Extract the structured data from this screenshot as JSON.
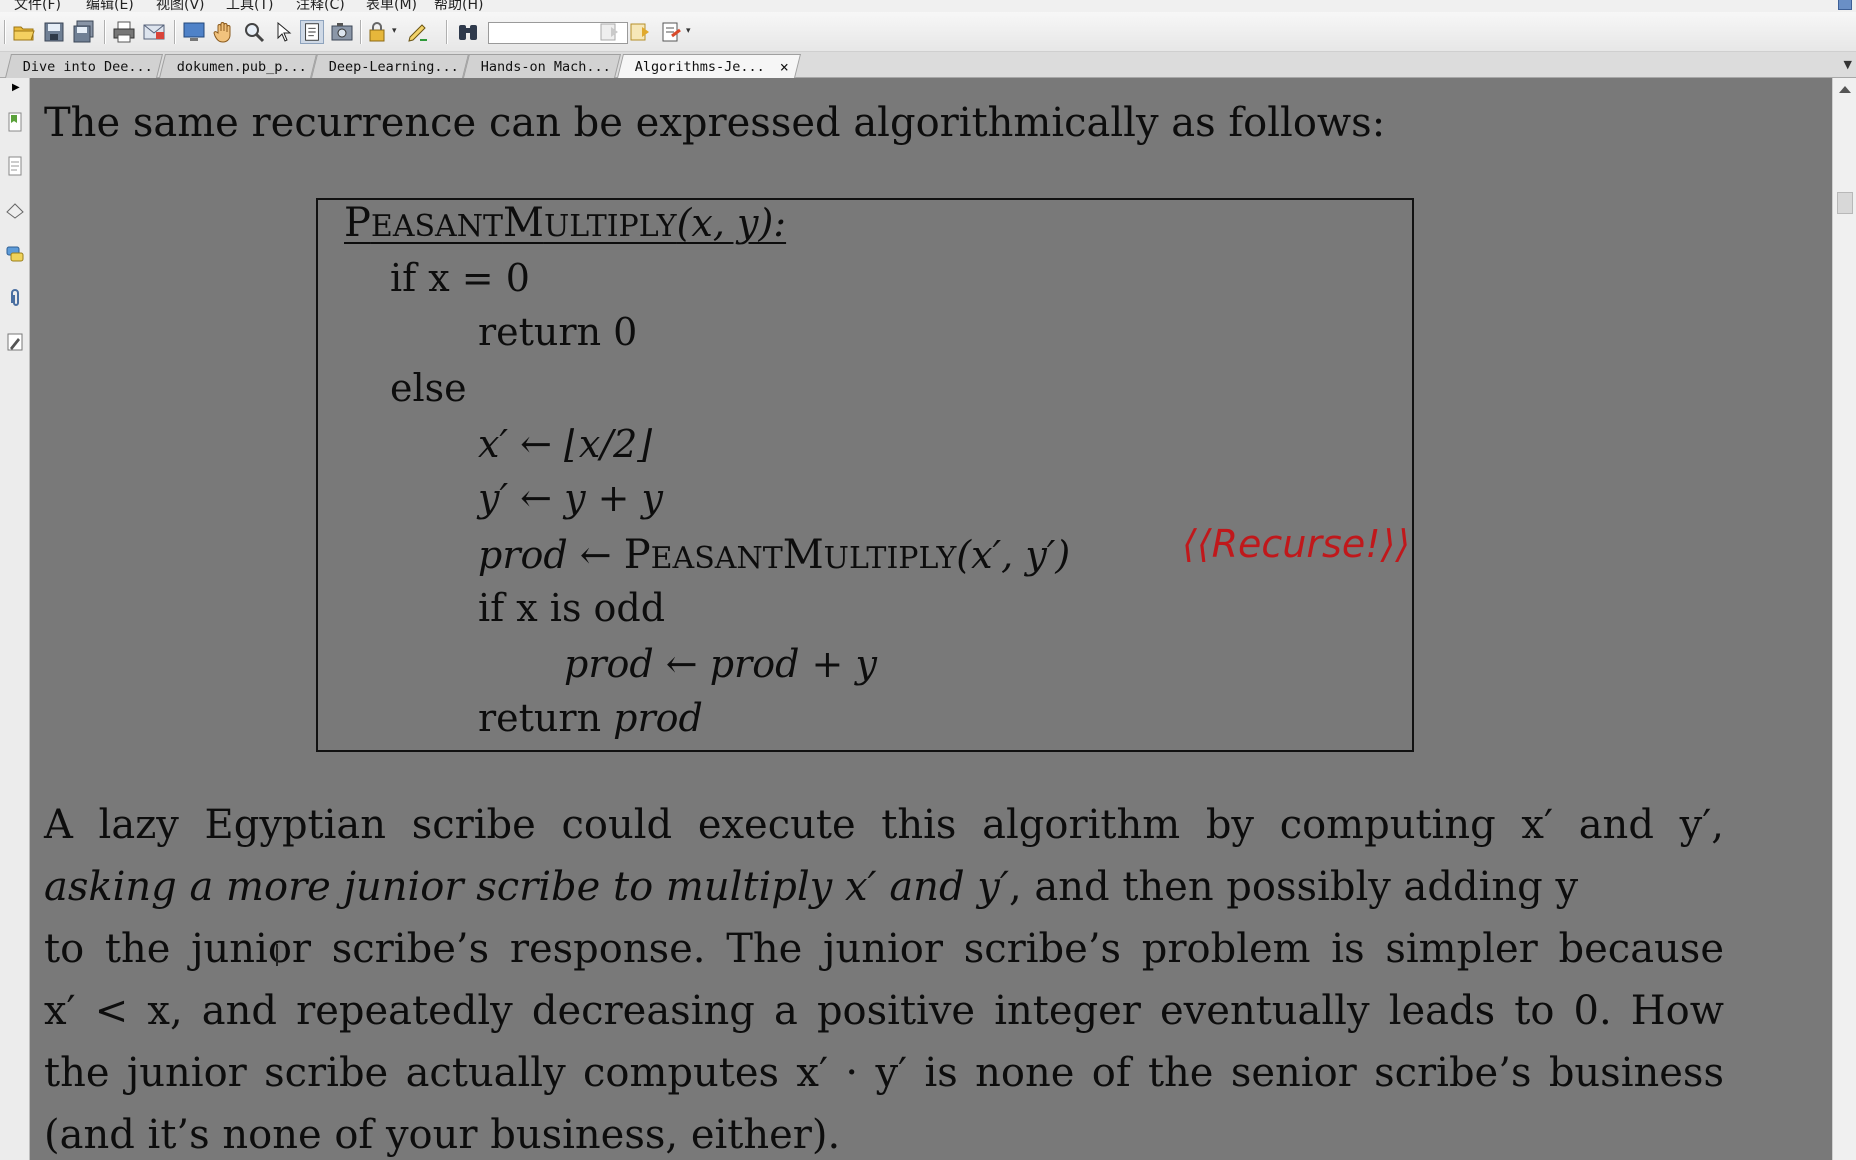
{
  "menu": [
    "文件(F)",
    "编辑(E)",
    "视图(V)",
    "工具(T)",
    "注释(C)",
    "表单(M)",
    "帮助(H)"
  ],
  "tabs": [
    {
      "label": "Dive into Dee..."
    },
    {
      "label": "dokumen.pub_p..."
    },
    {
      "label": "Deep-Learning..."
    },
    {
      "label": "Hands-on Mach..."
    },
    {
      "label": "Algorithms-Je...",
      "active": true
    }
  ],
  "close_glyph": "×",
  "document": {
    "intro": "The same recurrence can be expressed algorithmically as follows:",
    "algorithm": {
      "name_p": "P",
      "name_easant": "EASANT",
      "name_m": "M",
      "name_ultiply": "ULTIPLY",
      "signature": "(x, y):",
      "line1": "if x = 0",
      "line2": "return 0",
      "line3": "else",
      "line4": "x′ ← ⌊x/2⌋",
      "line5": "y′ ← y + y",
      "line6_lhs": "prod",
      "line6_arrow": "←",
      "line6_args": "(x′, y′)",
      "comment": "⟨⟨Recurse!⟩⟩",
      "line7": "if x is odd",
      "line8_a": "prod",
      "line8_b": "←",
      "line8_c": "prod",
      "line8_d": "+ y",
      "line9_a": "return",
      "line9_b": "prod"
    },
    "paragraph": {
      "l1": "A lazy Egyptian scribe could execute this algorithm by computing x′ and y′,",
      "l2_italic": "asking a more junior scribe to multiply x′ and y′",
      "l2_rest": ", and then possibly adding y",
      "l3": "to the junior scribe’s response. The junior scribe’s problem is simpler because",
      "l4": "x′ < x, and repeatedly decreasing a positive integer eventually leads to 0. How",
      "l5": "the junior scribe actually computes x′ · y′ is none of the senior scribe’s business",
      "l6": "(and it’s none of your business, either)."
    }
  }
}
